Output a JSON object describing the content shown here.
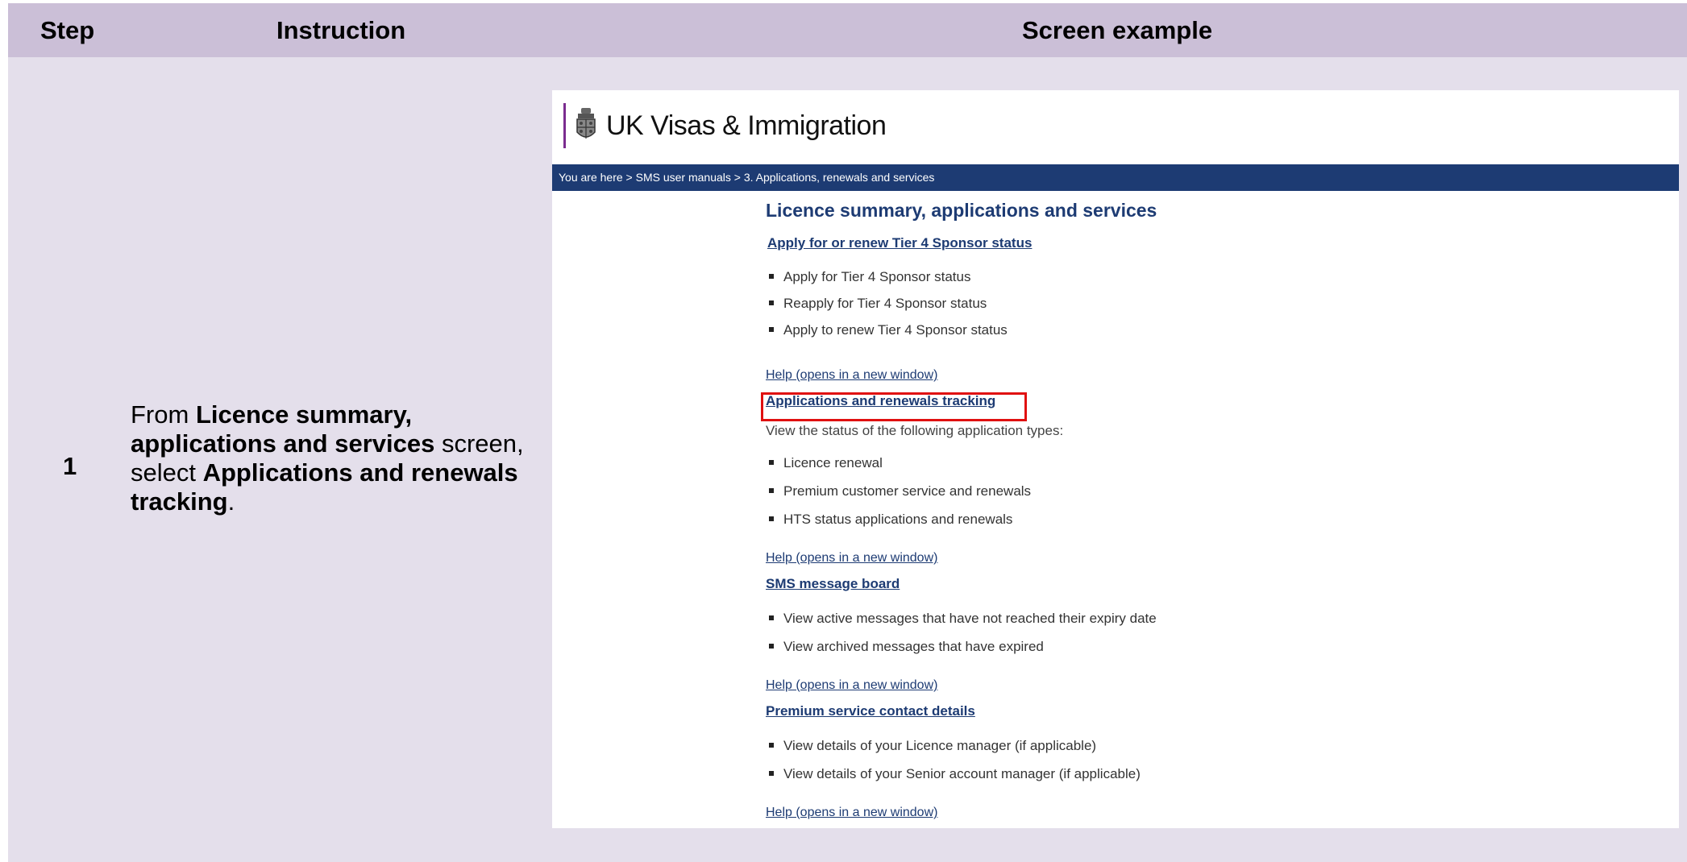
{
  "header": {
    "step": "Step",
    "instruction": "Instruction",
    "screen_example": "Screen example"
  },
  "row": {
    "step_number": "1",
    "instruction_parts": [
      {
        "text": "From ",
        "bold": false
      },
      {
        "text": "Licence summary, applications and services",
        "bold": true
      },
      {
        "text": " screen, select ",
        "bold": false
      },
      {
        "text": "Applications and renewals tracking",
        "bold": true
      },
      {
        "text": ".",
        "bold": false
      }
    ]
  },
  "screen": {
    "brand_name": "UK Visas & Immigration",
    "crest_icon": "royal-crest-icon",
    "breadcrumb": "You are here > SMS user manuals >  3. Applications, renewals and services",
    "page_heading": "Licence summary, applications and services",
    "sections": [
      {
        "title": "Apply for or renew Tier 4 Sponsor status",
        "description": "",
        "bullets": [
          "Apply for Tier 4 Sponsor status",
          "Reapply for Tier 4 Sponsor status",
          "Apply to renew Tier 4 Sponsor status"
        ],
        "help": "Help (opens in a new window)"
      },
      {
        "title": "Applications and renewals tracking",
        "description": "View the status of the following application types:",
        "bullets": [
          "Licence renewal",
          "Premium customer service and renewals",
          "HTS status applications and renewals"
        ],
        "help": "Help (opens in a new window)"
      },
      {
        "title": "SMS message board",
        "description": "",
        "bullets": [
          "View active messages that have not reached their expiry date",
          "View archived messages that have expired"
        ],
        "help": "Help (opens in a new window)"
      },
      {
        "title": "Premium service contact details",
        "description": "",
        "bullets": [
          "View details of your Licence manager (if applicable)",
          "View details of your Senior account manager (if applicable)"
        ],
        "help": "Help (opens in a new window)"
      }
    ],
    "highlight_color": "#e01010",
    "nav_color": "#1d3b73"
  }
}
